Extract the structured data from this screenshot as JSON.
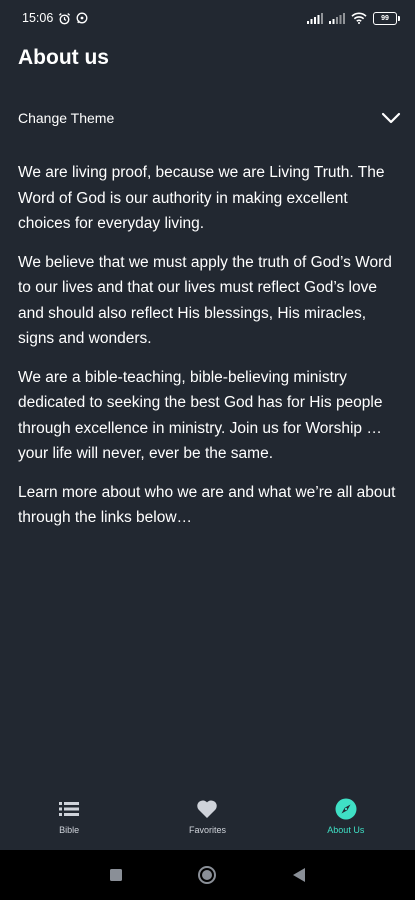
{
  "status_bar": {
    "time": "15:06",
    "battery": "99",
    "icons": [
      "alarm-icon",
      "whatsapp-icon",
      "cell-signal-icon",
      "cell-signal-icon",
      "wifi-icon",
      "battery-icon"
    ]
  },
  "header": {
    "title": "About us"
  },
  "theme": {
    "label": "Change Theme",
    "icon": "chevron-down-icon"
  },
  "content": {
    "paragraphs": [
      "We are living proof, because we are Living Truth. The Word of God is our authority in making excellent choices for everyday living.",
      "We believe that we must apply the truth of God’s Word to our lives and that our lives must reflect God’s love and should also reflect His blessings, His miracles, signs and wonders.",
      "We are a bible-teaching, bible-believing ministry dedicated to seeking the best God has for His people through excellence in ministry. Join us for Worship … your life will never, ever be the same.",
      "Learn more about who we are and what we’re all about through the links below…"
    ]
  },
  "bottom_nav": {
    "items": [
      {
        "label": "Bible",
        "icon": "list-icon",
        "active": false
      },
      {
        "label": "Favorites",
        "icon": "heart-icon",
        "active": false
      },
      {
        "label": "About Us",
        "icon": "compass-icon",
        "active": true
      }
    ]
  },
  "system_nav": {
    "buttons": [
      "square-icon",
      "circle-icon",
      "back-triangle-icon"
    ]
  },
  "colors": {
    "background": "#222831",
    "accent": "#3fe0c5",
    "text": "#ffffff",
    "system_bar": "#000000"
  }
}
